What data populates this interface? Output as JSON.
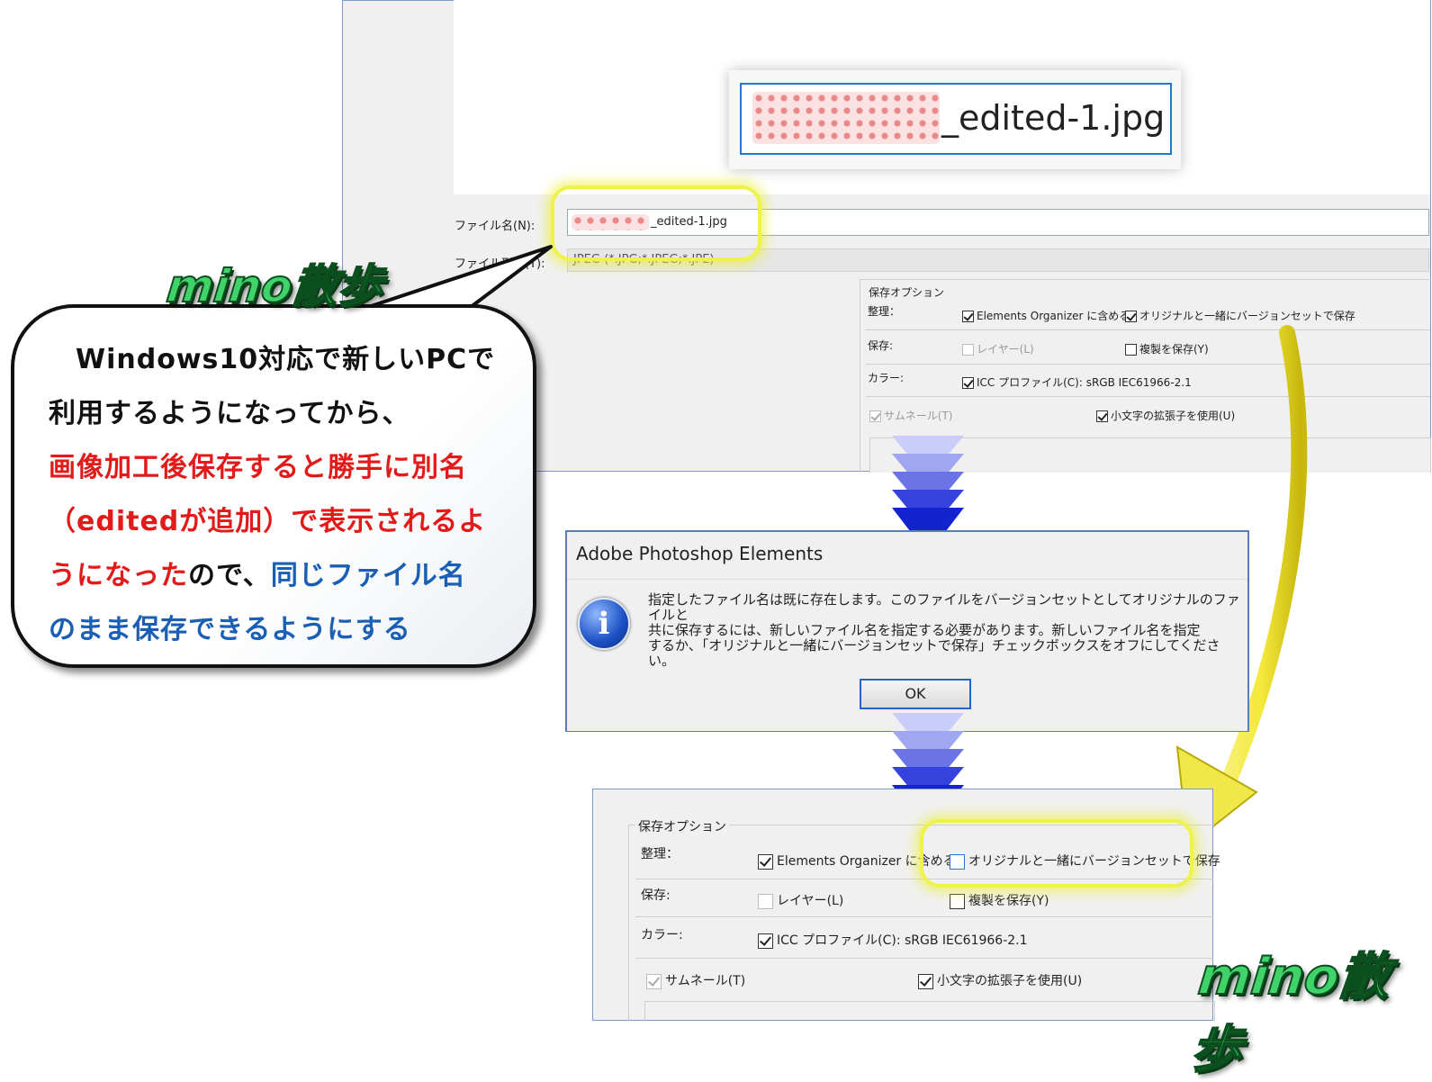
{
  "save_dialog": {
    "zoom_filename_suffix": "_edited-1.jpg",
    "filename_label": "ファイル名(N):",
    "filename_value_suffix": "_edited-1.jpg",
    "filetype_label": "ファイル形式(T):",
    "filetype_value": "JPEG (*.JPG;*.JPEG;*.JPE)",
    "save_options": {
      "heading": "保存オプション",
      "organize_label": "整理：",
      "include_organizer": {
        "label": "Elements Organizer に含める",
        "checked": true
      },
      "save_in_version_set": {
        "label": "オリジナルと一緒にバージョンセットで保存",
        "checked": true
      },
      "save_label": "保存:",
      "layers": {
        "label": "レイヤー(L)",
        "checked": false,
        "disabled": true
      },
      "as_copy": {
        "label": "複製を保存(Y)",
        "checked": false
      },
      "color_label": "カラー:",
      "icc_profile": {
        "label": "ICC プロファイル(C): sRGB IEC61966-2.1",
        "checked": true
      },
      "thumbnail": {
        "label": "サムネール(T)",
        "checked": true,
        "disabled": true
      },
      "lowercase_ext": {
        "label": "小文字の拡張子を使用(U)",
        "checked": true
      }
    }
  },
  "alert_dialog": {
    "title": "Adobe Photoshop Elements",
    "message_line1": "指定したファイル名は既に存在します。このファイルをバージョンセットとしてオリジナルのファイルと",
    "message_line2": "共に保存するには、新しいファイル名を指定する必要があります。新しいファイル名を指定",
    "message_line3": "するか、「オリジナルと一緒にバージョンセットで保存」チェックボックスをオフにしてください。",
    "ok_label": "OK"
  },
  "bottom_panel": {
    "heading": "保存オプション",
    "organize_label": "整理：",
    "include_organizer": {
      "label": "Elements Organizer に含める",
      "checked": true
    },
    "save_in_version_set": {
      "label": "オリジナルと一緒にバージョンセットで保存",
      "checked": false
    },
    "save_label": "保存:",
    "layers": {
      "label": "レイヤー(L)",
      "checked": false,
      "disabled": true
    },
    "as_copy": {
      "label": "複製を保存(Y)",
      "checked": false
    },
    "color_label": "カラー:",
    "icc_profile": {
      "label": "ICC プロファイル(C): sRGB IEC61966-2.1",
      "checked": true
    },
    "thumbnail": {
      "label": "サムネール(T)",
      "checked": true,
      "disabled": true
    },
    "lowercase_ext": {
      "label": "小文字の拡張子を使用(U)",
      "checked": true
    }
  },
  "callout": {
    "line1": "Windows10対応で新しいPCで",
    "line2": "利用するようになってから、",
    "line3_red": "画像加工後保存すると勝手に別名",
    "line4_red": "（editedが追加）で表示されるよ",
    "line5_red": "うになった",
    "line5_black": "ので、",
    "line5_blue": "同じファイル名",
    "line6_blue": "のまま保存できるようにする"
  },
  "logo_text": "mino散歩",
  "colors": {
    "highlight": "#eef24a",
    "red_text": "#e21a1a",
    "blue_text": "#1a5fb4",
    "arrow_yellow": "#f0e84a",
    "chevron_blue": "#2b3fd8",
    "logo_green": "#3fd36a"
  }
}
